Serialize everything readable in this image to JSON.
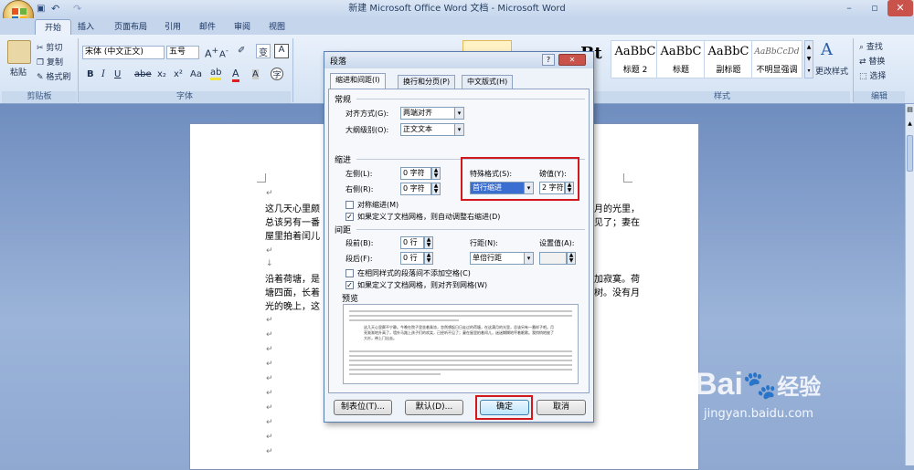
{
  "window": {
    "title": "新建 Microsoft Office Word 文档 - Microsoft Word"
  },
  "tabs": [
    "开始",
    "插入",
    "页面布局",
    "引用",
    "邮件",
    "审阅",
    "视图"
  ],
  "clipboard": {
    "paste": "粘贴",
    "cut": "剪切",
    "copy": "复制",
    "format_painter": "格式刷",
    "group": "剪贴板"
  },
  "font": {
    "name": "宋体 (中文正文)",
    "size": "五号",
    "group": "字体"
  },
  "styles": {
    "items": [
      {
        "preview": "AaBbC",
        "label": "标题 2"
      },
      {
        "preview": "AaBbC",
        "label": "标题"
      },
      {
        "preview": "AaBbC",
        "label": "副标题"
      },
      {
        "preview": "AaBbCcDd",
        "label": "不明显强调"
      }
    ],
    "change": "更改样式",
    "group": "样式"
  },
  "editing": {
    "find": "查找",
    "replace": "替换",
    "select": "选择",
    "group": "编辑"
  },
  "document": {
    "lines": [
      "这几天心里颇",
      "总该另有一番",
      "屋里拍着闰儿",
      "沿着荷塘，是",
      "塘四面，长着",
      "光的晚上，这"
    ],
    "right_fragments": [
      "月的光里，",
      "见了；妻在",
      "加寂寞。荷",
      "树。没有月"
    ]
  },
  "dialog": {
    "title": "段落",
    "tabs": [
      "缩进和间距(I)",
      "换行和分页(P)",
      "中文版式(H)"
    ],
    "general": {
      "heading": "常规",
      "alignment_label": "对齐方式(G):",
      "alignment_value": "两端对齐",
      "outline_label": "大纲级别(O):",
      "outline_value": "正文文本"
    },
    "indent": {
      "heading": "缩进",
      "left_label": "左侧(L):",
      "left_value": "0 字符",
      "right_label": "右侧(R):",
      "right_value": "0 字符",
      "special_label": "特殊格式(S):",
      "special_value": "首行缩进",
      "by_label": "磅值(Y):",
      "by_value": "2 字符",
      "mirror_label": "对称缩进(M)",
      "grid_label": "如果定义了文档网格，则自动调整右缩进(D)"
    },
    "spacing": {
      "heading": "间距",
      "before_label": "段前(B):",
      "before_value": "0 行",
      "after_label": "段后(F):",
      "after_value": "0 行",
      "line_label": "行距(N):",
      "line_value": "单倍行距",
      "at_label": "设置值(A):",
      "at_value": "",
      "nospace_label": "在相同样式的段落间不添加空格(C)",
      "snap_label": "如果定义了文档网格，则对齐到网格(W)"
    },
    "preview": {
      "heading": "预览",
      "text": "这几天心里颇不宁静。今晚在院子里坐着乘凉，忽然想起日日走过的荷塘，在这满月的光里，总该另有一番样子吧。月亮渐渐地升高了，墙外马路上孩子们的欢笑，已经听不见了；妻在屋里拍着闰儿，迷迷糊糊地哼着眠歌。我悄悄地披了大衫，带上门出去。"
    },
    "buttons": {
      "tabs": "制表位(T)...",
      "default": "默认(D)...",
      "ok": "确定",
      "cancel": "取消"
    }
  },
  "watermark": {
    "brand": "Bai",
    "brand2": "经验",
    "url": "jingyan.baidu.com"
  }
}
